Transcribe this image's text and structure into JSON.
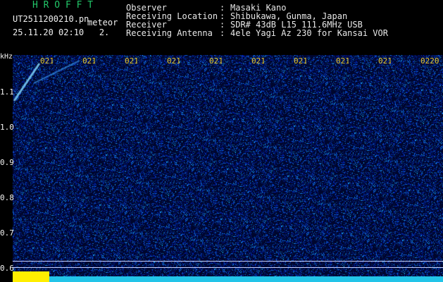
{
  "app": {
    "title": "H R O F F T"
  },
  "file": {
    "name": "UT2511200210.pn",
    "meteor_word": "meteor",
    "timestamp": "25.11.20 02:10   2."
  },
  "info": [
    {
      "label": "Observer",
      "sep": ":",
      "value": "Masaki Kano"
    },
    {
      "label": "Receiving Location",
      "sep": ":",
      "value": "Shibukawa, Gunma, Japan"
    },
    {
      "label": "Receiver",
      "sep": ":",
      "value": "SDR# 43dB L15 111.6MHz USB"
    },
    {
      "label": "Receiving Antenna",
      "sep": ":",
      "value": "4ele Yagi Az 230 for Kansai VOR"
    }
  ],
  "spectrogram": {
    "y_unit": "kHz",
    "y_ticks": [
      "1.1",
      "1.0",
      "0.9",
      "0.8",
      "0.7",
      "0.6"
    ],
    "x_ticks": [
      "021",
      "021",
      "021",
      "021",
      "021",
      "021",
      "021",
      "021",
      "021",
      "0220"
    ],
    "background_color": "#00062e",
    "signal_color": "#7fd6ff"
  },
  "level_meter": {
    "left_color": "#ffee00",
    "right_color": "#22c4e8"
  }
}
